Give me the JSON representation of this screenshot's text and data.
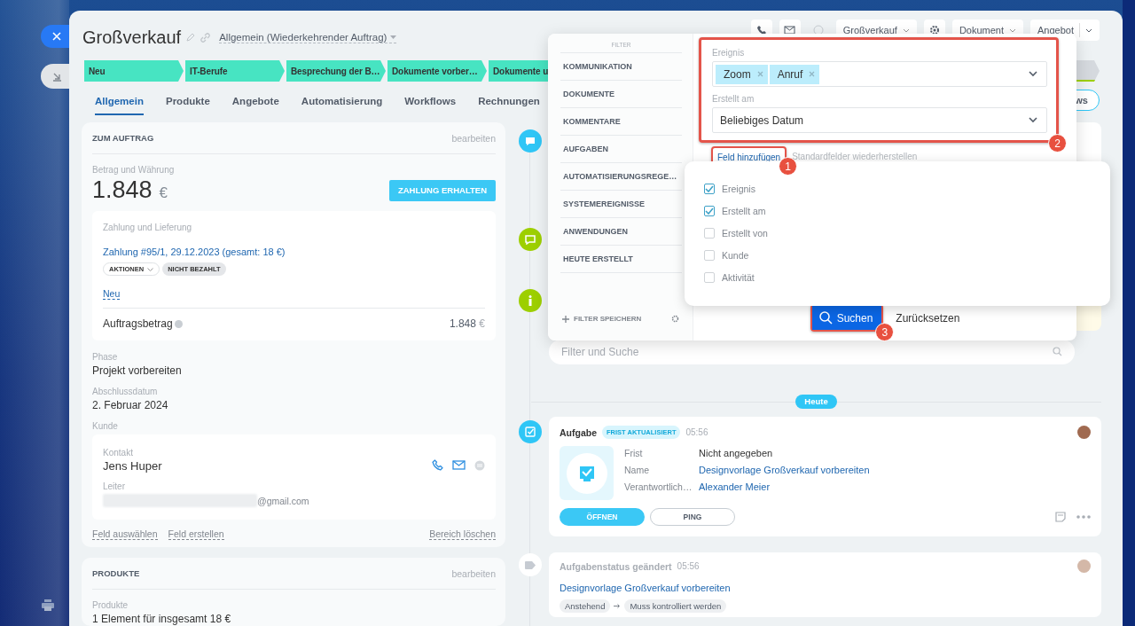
{
  "header": {
    "title": "Großverkauf",
    "category": "Allgemein (Wiederkehrender Auftrag)"
  },
  "toolbar": [
    {
      "kind": "phone"
    },
    {
      "kind": "mail"
    },
    {
      "kind": "muted"
    },
    {
      "kind": "menu",
      "label": "Großverkauf"
    },
    {
      "kind": "gear"
    },
    {
      "kind": "menu",
      "label": "Dokument"
    },
    {
      "kind": "split",
      "label": "Angebot"
    }
  ],
  "stages": [
    {
      "label": "Neu",
      "reached": true
    },
    {
      "label": "IT-Berufe",
      "reached": true
    },
    {
      "label": "Besprechung der B…",
      "reached": true
    },
    {
      "label": "Dokumente vorber…",
      "reached": true
    },
    {
      "label": "Dokumente u",
      "reached": true
    },
    {
      "reached": false
    }
  ],
  "tabs": [
    {
      "label": "Allgemein",
      "selected": true
    },
    {
      "label": "Produkte",
      "selected": false
    },
    {
      "label": "Angebote",
      "selected": false
    },
    {
      "label": "Automatisierung",
      "selected": false
    },
    {
      "label": "Workflows",
      "selected": false
    },
    {
      "label": "Rechnungen",
      "selected": false
    }
  ],
  "tab_button": "ws",
  "order": {
    "title": "ZUM AUFTRAG",
    "edit": "bearbeiten",
    "amount_label": "Betrag und Währung",
    "amount": "1.848",
    "currency": "€",
    "pay_button": "ZAHLUNG ERHALTEN",
    "payment": {
      "label": "Zahlung und Lieferung",
      "link": "Zahlung #95/1, 29.12.2023 (gesamt: 18 €)",
      "actions": "AKTIONEN",
      "status": "NICHT BEZAHLT",
      "new": "Neu",
      "total_label": "Auftragsbetrag",
      "total": "1.848",
      "total_currency": "€"
    },
    "fields": [
      {
        "label": "Phase",
        "value": "Projekt vorbereiten"
      },
      {
        "label": "Abschlussdatum",
        "value": "2. Februar 2024"
      }
    ],
    "client": {
      "label": "Kunde",
      "contact_label": "Kontakt",
      "name": "Jens Huper",
      "role": "Leiter",
      "email": "@gmail.com"
    },
    "footer_links": [
      "Feld auswählen",
      "Feld erstellen"
    ],
    "clear": "Bereich löschen"
  },
  "products": {
    "title": "PRODUKTE",
    "edit": "bearbeiten",
    "label": "Produkte",
    "value": "1 Element für insgesamt 18 €"
  },
  "filter": {
    "title": "FILTER",
    "presets": [
      "KOMMUNIKATION",
      "DOKUMENTE",
      "KOMMENTARE",
      "AUFGABEN",
      "AUTOMATISIERUNGSREGE…",
      "SYSTEMEREIGNISSE",
      "ANWENDUNGEN",
      "HEUTE ERSTELLT"
    ],
    "save": "FILTER SPEICHERN",
    "fields": [
      {
        "kind": "tags",
        "label": "Ereignis",
        "tags": [
          "Zoom",
          "Anruf"
        ]
      },
      {
        "kind": "select",
        "label": "Erstellt am",
        "value": "Beliebiges Datum"
      }
    ],
    "add_field": "Feld hinzufügen",
    "restore": "Standardfelder wiederherstellen",
    "options": [
      {
        "label": "Ereignis",
        "checked": true
      },
      {
        "label": "Erstellt am",
        "checked": true
      },
      {
        "label": "Erstellt von",
        "checked": false
      },
      {
        "label": "Kunde",
        "checked": false
      },
      {
        "label": "Aktivität",
        "checked": false
      }
    ],
    "search": "Suchen",
    "reset": "Zurücksetzen"
  },
  "annotations": [
    {
      "number": "1"
    },
    {
      "number": "2"
    },
    {
      "number": "3"
    }
  ],
  "timeline": {
    "markers": [
      {
        "kind": "comment"
      },
      {
        "kind": "message"
      },
      {
        "kind": "info"
      }
    ],
    "search": {
      "placeholder": "Filter und Suche"
    },
    "day": "Heute",
    "task": {
      "title": "Aufgabe",
      "badge": "FRIST AKTUALISIERT",
      "time": "05:56",
      "rows": [
        {
          "label": "Frist",
          "value": "Nicht angegeben",
          "link": false
        },
        {
          "label": "Name",
          "value": "Designvorlage Großverkauf vorbereiten",
          "link": true
        },
        {
          "label": "Verantwortlich…",
          "value": "Alexander Meier",
          "link": true
        }
      ],
      "buttons": [
        {
          "label": "ÖFFNEN",
          "primary": true
        },
        {
          "label": "PING",
          "primary": false
        }
      ]
    },
    "status_change": {
      "title": "Aufgabenstatus geändert",
      "time": "05:56",
      "link": "Designvorlage Großverkauf vorbereiten",
      "from": "Anstehend",
      "to": "Muss kontrolliert werden"
    }
  }
}
